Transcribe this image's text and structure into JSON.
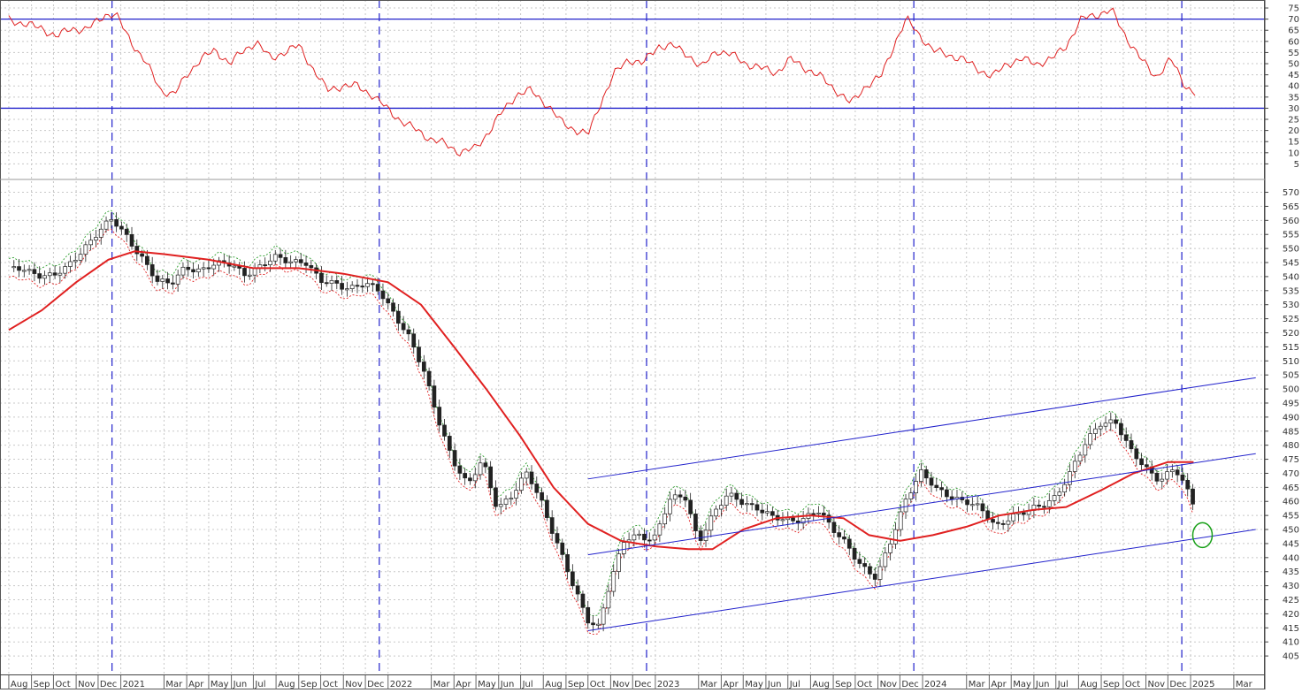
{
  "chart_data": [
    {
      "type": "line",
      "panel": "indicator",
      "y_ticks": [
        5,
        10,
        15,
        20,
        25,
        30,
        35,
        40,
        45,
        50,
        55,
        60,
        65,
        70,
        75
      ],
      "ylim": [
        0,
        77
      ],
      "reference_lines": [
        30,
        70
      ],
      "grid": true,
      "colors": {
        "series": "#e02020",
        "reference": "#2222cc"
      },
      "series": [
        {
          "x": [
            "2020-08-01",
            "2020-08-20",
            "2020-09-15",
            "2020-10-05",
            "2020-10-25",
            "2020-11-15",
            "2020-12-10",
            "2020-12-25",
            "2021-01-15",
            "2021-02-05",
            "2021-02-25",
            "2021-03-15",
            "2021-04-01",
            "2021-04-20",
            "2021-05-10",
            "2021-05-30",
            "2021-06-15",
            "2021-07-05",
            "2021-07-25",
            "2021-08-10",
            "2021-09-01",
            "2021-09-20",
            "2021-10-10",
            "2021-10-30",
            "2021-11-20",
            "2021-12-10",
            "2021-12-30",
            "2022-01-20",
            "2022-02-10",
            "2022-03-01",
            "2022-03-20",
            "2022-04-10",
            "2022-04-30",
            "2022-05-20",
            "2022-06-05",
            "2022-06-25",
            "2022-07-15",
            "2022-08-05",
            "2022-08-25",
            "2022-09-15",
            "2022-10-01",
            "2022-10-15",
            "2022-11-05",
            "2022-11-25",
            "2022-12-15",
            "2023-01-05",
            "2023-01-25",
            "2023-02-15",
            "2023-03-05",
            "2023-03-25",
            "2023-04-15",
            "2023-05-05",
            "2023-05-25",
            "2023-06-15",
            "2023-07-05",
            "2023-07-25",
            "2023-08-15",
            "2023-09-05",
            "2023-09-25",
            "2023-10-15",
            "2023-11-05",
            "2023-11-25",
            "2023-12-10",
            "2023-12-25",
            "2024-01-15",
            "2024-02-05",
            "2024-02-25",
            "2024-03-15",
            "2024-04-05",
            "2024-04-25",
            "2024-05-15",
            "2024-06-05",
            "2024-06-25",
            "2024-07-15",
            "2024-08-05",
            "2024-08-25",
            "2024-09-15",
            "2024-10-05",
            "2024-10-25",
            "2024-11-15",
            "2024-12-05",
            "2024-12-25",
            "2025-01-10"
          ],
          "values": [
            70,
            68,
            66,
            62,
            66,
            65,
            72,
            72,
            60,
            50,
            38,
            36,
            45,
            52,
            56,
            50,
            55,
            60,
            52,
            55,
            58,
            48,
            38,
            40,
            40,
            36,
            30,
            24,
            20,
            16,
            14,
            10,
            12,
            20,
            28,
            36,
            38,
            32,
            24,
            20,
            18,
            30,
            45,
            52,
            50,
            58,
            58,
            54,
            48,
            56,
            54,
            50,
            48,
            46,
            52,
            48,
            44,
            38,
            32,
            40,
            44,
            60,
            70,
            64,
            56,
            54,
            52,
            48,
            44,
            50,
            52,
            50,
            52,
            58,
            70,
            72,
            74,
            62,
            52,
            44,
            52,
            40,
            36
          ]
        }
      ]
    },
    {
      "type": "line",
      "panel": "price",
      "y_ticks": [
        405,
        410,
        415,
        420,
        425,
        430,
        435,
        440,
        445,
        450,
        455,
        460,
        465,
        470,
        475,
        480,
        485,
        490,
        495,
        500,
        505,
        510,
        515,
        520,
        525,
        530,
        535,
        540,
        545,
        550,
        555,
        560,
        565,
        570
      ],
      "ylim": [
        400,
        573
      ],
      "grid": true,
      "x_tick_labels": [
        "Aug",
        "Sep",
        "Oct",
        "Nov",
        "Dec",
        "2021",
        "Mar",
        "Apr",
        "May",
        "Jun",
        "Jul",
        "Aug",
        "Sep",
        "Oct",
        "Nov",
        "Dec",
        "2022",
        "Mar",
        "Apr",
        "May",
        "Jun",
        "Jul",
        "Aug",
        "Sep",
        "Oct",
        "Nov",
        "Dec",
        "2023",
        "Mar",
        "Apr",
        "May",
        "Jun",
        "Jul",
        "Aug",
        "Sep",
        "Oct",
        "Nov",
        "Dec",
        "2024",
        "Mar",
        "Apr",
        "May",
        "Jun",
        "Jul",
        "Aug",
        "Sep",
        "Oct",
        "Nov",
        "Dec",
        "2025",
        "Mar"
      ],
      "x_tick_dates": [
        "2020-08-01",
        "2020-09-01",
        "2020-10-01",
        "2020-11-01",
        "2020-12-01",
        "2021-01-01",
        "2021-03-01",
        "2021-04-01",
        "2021-05-01",
        "2021-06-01",
        "2021-07-01",
        "2021-08-01",
        "2021-09-01",
        "2021-10-01",
        "2021-11-01",
        "2021-12-01",
        "2022-01-01",
        "2022-03-01",
        "2022-04-01",
        "2022-05-01",
        "2022-06-01",
        "2022-07-01",
        "2022-08-01",
        "2022-09-01",
        "2022-10-01",
        "2022-11-01",
        "2022-12-01",
        "2023-01-01",
        "2023-03-01",
        "2023-04-01",
        "2023-05-01",
        "2023-06-01",
        "2023-07-01",
        "2023-08-01",
        "2023-09-01",
        "2023-10-01",
        "2023-11-01",
        "2023-12-01",
        "2024-01-01",
        "2024-03-01",
        "2024-04-01",
        "2024-05-01",
        "2024-06-01",
        "2024-07-01",
        "2024-08-01",
        "2024-09-01",
        "2024-10-01",
        "2024-11-01",
        "2024-12-01",
        "2025-01-01",
        "2025-03-01"
      ],
      "vertical_markers": [
        "2020-12-20",
        "2021-12-20",
        "2022-12-20",
        "2023-12-20",
        "2024-12-20"
      ],
      "colors": {
        "price": "#222222",
        "moving_average": "#e02020",
        "band_upper": "#2e9e2e",
        "band_lower": "#e02020",
        "channel": "#2222cc",
        "marker": "#2222cc",
        "target": "#18a018"
      },
      "series": [
        {
          "role": "price",
          "x": [
            "2020-08-01",
            "2020-08-20",
            "2020-09-10",
            "2020-10-01",
            "2020-10-20",
            "2020-11-10",
            "2020-12-01",
            "2020-12-20",
            "2021-01-10",
            "2021-01-30",
            "2021-02-20",
            "2021-03-10",
            "2021-03-30",
            "2021-04-20",
            "2021-05-10",
            "2021-06-01",
            "2021-06-20",
            "2021-07-10",
            "2021-08-01",
            "2021-08-20",
            "2021-09-10",
            "2021-09-30",
            "2021-10-20",
            "2021-11-10",
            "2021-11-30",
            "2021-12-20",
            "2022-01-10",
            "2022-01-30",
            "2022-02-20",
            "2022-03-10",
            "2022-03-30",
            "2022-04-20",
            "2022-05-10",
            "2022-05-30",
            "2022-06-20",
            "2022-07-10",
            "2022-07-30",
            "2022-08-20",
            "2022-09-10",
            "2022-09-30",
            "2022-10-15",
            "2022-10-30",
            "2022-11-20",
            "2022-12-10",
            "2022-12-30",
            "2023-01-20",
            "2023-02-10",
            "2023-03-01",
            "2023-03-20",
            "2023-04-10",
            "2023-04-30",
            "2023-05-20",
            "2023-06-10",
            "2023-06-30",
            "2023-07-20",
            "2023-08-10",
            "2023-08-30",
            "2023-09-20",
            "2023-10-10",
            "2023-10-30",
            "2023-11-20",
            "2023-12-10",
            "2023-12-30",
            "2024-01-20",
            "2024-02-10",
            "2024-03-01",
            "2024-03-20",
            "2024-04-10",
            "2024-04-30",
            "2024-05-20",
            "2024-06-10",
            "2024-06-30",
            "2024-07-20",
            "2024-08-10",
            "2024-08-30",
            "2024-09-20",
            "2024-10-10",
            "2024-10-30",
            "2024-11-20",
            "2024-12-10",
            "2024-12-30",
            "2025-01-10"
          ],
          "values": [
            542,
            543,
            541,
            540,
            543,
            550,
            556,
            560,
            554,
            547,
            538,
            537,
            544,
            542,
            544,
            545,
            541,
            543,
            547,
            546,
            545,
            538,
            538,
            536,
            537,
            535,
            527,
            518,
            505,
            490,
            475,
            465,
            475,
            458,
            462,
            470,
            460,
            445,
            430,
            418,
            416,
            430,
            446,
            448,
            447,
            460,
            462,
            446,
            455,
            462,
            460,
            458,
            454,
            453,
            454,
            457,
            450,
            445,
            437,
            432,
            447,
            462,
            470,
            464,
            462,
            460,
            457,
            451,
            455,
            456,
            458,
            462,
            470,
            480,
            488,
            489,
            478,
            472,
            468,
            472,
            462,
            456
          ]
        },
        {
          "role": "moving_average",
          "x": [
            "2020-08-01",
            "2020-09-15",
            "2020-11-01",
            "2020-12-15",
            "2021-01-20",
            "2021-03-01",
            "2021-05-01",
            "2021-07-01",
            "2021-09-01",
            "2021-11-01",
            "2022-01-01",
            "2022-02-15",
            "2022-04-01",
            "2022-05-15",
            "2022-07-01",
            "2022-08-15",
            "2022-10-01",
            "2022-11-15",
            "2023-01-01",
            "2023-02-15",
            "2023-03-20",
            "2023-05-01",
            "2023-06-15",
            "2023-08-01",
            "2023-09-15",
            "2023-10-20",
            "2023-12-01",
            "2024-01-15",
            "2024-03-01",
            "2024-04-15",
            "2024-06-01",
            "2024-07-15",
            "2024-09-01",
            "2024-10-15",
            "2024-12-01",
            "2025-01-05"
          ],
          "values": [
            521,
            528,
            538,
            546,
            549,
            548,
            546,
            543,
            543,
            541,
            538,
            530,
            515,
            500,
            483,
            465,
            452,
            446,
            444,
            443,
            443,
            450,
            454,
            455,
            454,
            448,
            446,
            448,
            451,
            455,
            457,
            458,
            464,
            470,
            474,
            474
          ]
        }
      ],
      "channel_lines": [
        {
          "x": [
            "2022-10-01",
            "2025-03-31"
          ],
          "values": [
            468,
            504
          ]
        },
        {
          "x": [
            "2022-10-01",
            "2025-03-31"
          ],
          "values": [
            441,
            477
          ]
        },
        {
          "x": [
            "2022-10-01",
            "2025-03-31"
          ],
          "values": [
            414,
            450
          ]
        }
      ],
      "target": {
        "x": "2025-01-10",
        "value": 448
      }
    }
  ]
}
